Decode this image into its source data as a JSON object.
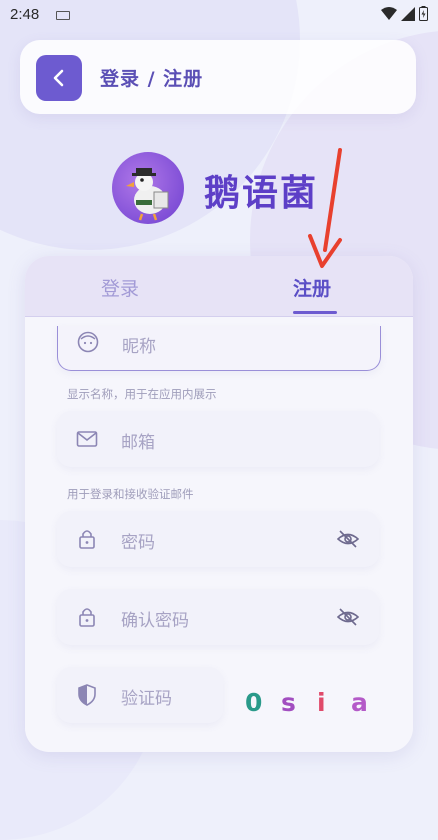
{
  "status_bar": {
    "time": "2:48"
  },
  "header": {
    "title": "登录 / 注册"
  },
  "app": {
    "name": "鹅语菌"
  },
  "tabs": [
    {
      "label": "登录",
      "selected": false
    },
    {
      "label": "注册",
      "selected": true
    }
  ],
  "form": {
    "nickname": {
      "placeholder": "昵称",
      "helper": "显示名称，用于在应用内展示"
    },
    "email": {
      "placeholder": "邮箱",
      "helper": "用于登录和接收验证邮件"
    },
    "password": {
      "placeholder": "密码"
    },
    "confirm_password": {
      "placeholder": "确认密码"
    },
    "captcha": {
      "placeholder": "验证码",
      "chars": [
        {
          "char": "0",
          "color": "#2a9a8a"
        },
        {
          "char": "s",
          "color": "#a24ec0"
        },
        {
          "char": "i",
          "color": "#e04a6a"
        },
        {
          "char": "a",
          "color": "#b45ac8"
        }
      ]
    }
  },
  "colors": {
    "accent": "#6d5bd0",
    "arrow": "#e8402e"
  }
}
